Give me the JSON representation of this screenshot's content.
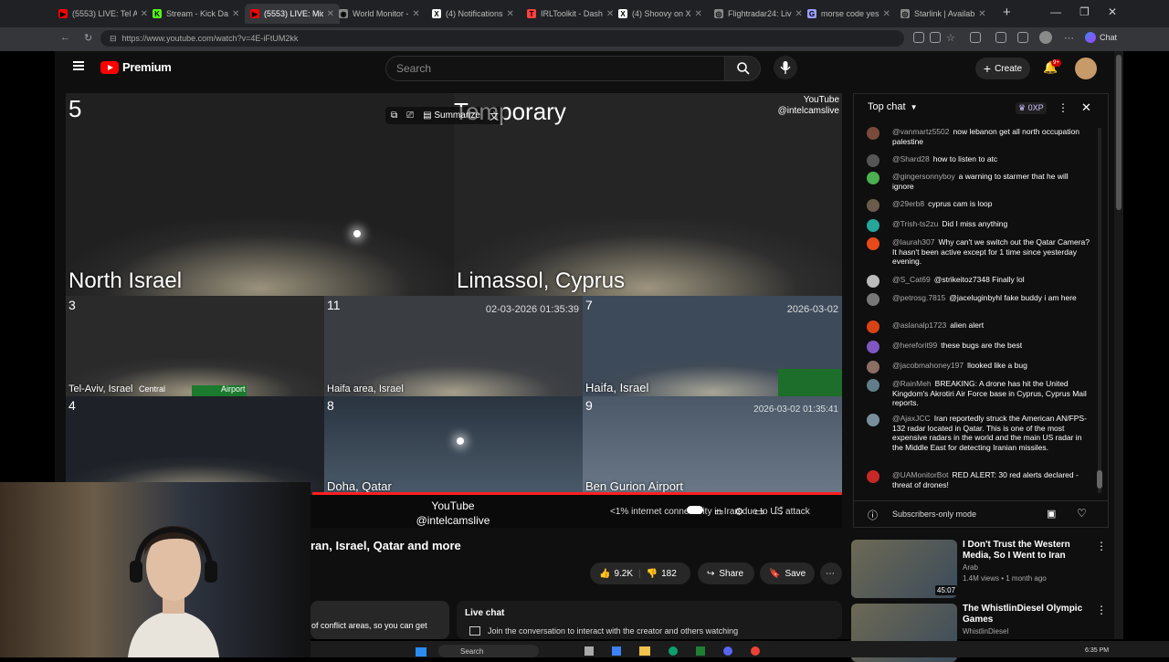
{
  "browser": {
    "tabs": [
      {
        "title": "(5553) LIVE: Tel A",
        "color": "#ff0000",
        "glyph": "▶"
      },
      {
        "title": "Stream - Kick Da",
        "color": "#53fc18",
        "glyph": "K"
      },
      {
        "title": "(5553) LIVE: Mid",
        "color": "#ff0000",
        "glyph": "▶",
        "active": true
      },
      {
        "title": "World Monitor -",
        "color": "#888888",
        "glyph": "◉"
      },
      {
        "title": "(4) Notifications",
        "color": "#ffffff",
        "glyph": "X"
      },
      {
        "title": "IRLToolkit - Dash",
        "color": "#ff4040",
        "glyph": "T"
      },
      {
        "title": "(4) Shoovy on X",
        "color": "#ffffff",
        "glyph": "X"
      },
      {
        "title": "Flightradar24: Liv",
        "color": "#888888",
        "glyph": "◎"
      },
      {
        "title": "morse code yes",
        "color": "#9aa0ff",
        "glyph": "G"
      },
      {
        "title": "Starlink | Availab",
        "color": "#888888",
        "glyph": "◎"
      }
    ],
    "url": "https://www.youtube.com/watch?v=4E-iFtUM2kk",
    "chat_label": "Chat"
  },
  "youtube": {
    "brand": "Premium",
    "search_placeholder": "Search",
    "create_label": "Create",
    "notif_count": "9+",
    "video": {
      "overlay_temporary": "Temporary",
      "summarize_label": "Summarize",
      "channel_watermark": "YouTube\n@intelcamslive",
      "center_watermark_line1": "YouTube",
      "center_watermark_line2": "@intelcamslive",
      "status_text": "<1% internet connectivity in Iran due to US attack",
      "cams": [
        {
          "num": "5",
          "label": "North Israel"
        },
        {
          "num": "",
          "label": "Limassol, Cyprus"
        },
        {
          "num": "3",
          "label": "Tel-Aviv, Israel",
          "extra1": "Central",
          "extra2": "Airport"
        },
        {
          "num": "11",
          "label": "Haifa area, Israel",
          "ts": "02-03-2026 01:35:39"
        },
        {
          "num": "7",
          "label": "Haifa, Israel",
          "ts": "2026-03-02"
        },
        {
          "num": "4",
          "label": ""
        },
        {
          "num": "8",
          "label": "Doha, Qatar"
        },
        {
          "num": "9",
          "label": "Ben Gurion Airport",
          "ts": "2026-03-02 01:35:41"
        }
      ]
    },
    "title": "ran, Israel, Qatar and more",
    "likes": "9.2K",
    "dislikes": "182",
    "share_label": "Share",
    "save_label": "Save",
    "description_snippet": "of conflict areas, so you can get",
    "live_chat_title": "Live chat",
    "live_chat_text": "Join the conversation to interact with the creator and others watching"
  },
  "chat": {
    "header": "Top chat",
    "xp_badge": "0XP",
    "messages": [
      {
        "author": "@vanmartz5502",
        "text": "now lebanon get all north occupation palestine",
        "color": "#7a4b3a"
      },
      {
        "author": "@Shard28",
        "text": "how to listen to atc",
        "color": "#555555"
      },
      {
        "author": "@gingersonnyboy",
        "text": "a warning to starmer that he will ignore",
        "color": "#4caf50"
      },
      {
        "author": "@29erb8",
        "text": "cyprus cam is loop",
        "color": "#6b5b4b"
      },
      {
        "author": "@Trish-ts2zu",
        "text": "Did I miss anything",
        "color": "#26a69a"
      },
      {
        "author": "@laurah307",
        "text": "Why can't we switch out the Qatar Camera? It hasn't been active except for 1 time since yesterday evening.",
        "color": "#e64a19"
      },
      {
        "author": "@S_Cat69",
        "text": "@strikeitoz7348 Finally lol",
        "color": "#bbbbbb"
      },
      {
        "author": "@petrosg.7815",
        "text": "@jaceluginbyhl fake buddy i am here",
        "color": "#777777"
      },
      {
        "author": "@aslanalp1723",
        "text": "alien alert",
        "color": "#d84315"
      },
      {
        "author": "@hereforit99",
        "text": "these bugs are the best",
        "color": "#7e57c2"
      },
      {
        "author": "@jacobmahoney197",
        "text": "llooked like a bug",
        "color": "#8d6e63"
      },
      {
        "author": "@RainMeh",
        "text": "BREAKING: A drone has hit the United Kingdom's Akrotiri Air Force base in Cyprus, Cyprus Mail reports.",
        "color": "#607d8b"
      },
      {
        "author": "@AjaxJCC",
        "text": "Iran reportedly struck the American AN/FPS-132 radar located in Qatar. This is one of the most expensive radars in the world and the main US radar in the Middle East for detecting Iranian missiles.",
        "color": "#78909c"
      },
      {
        "author": "@UAMonitorBot",
        "text": "RED ALERT: 30 red alerts declared - threat of drones!",
        "color": "#c62828"
      }
    ],
    "subscribers_only": "Subscribers-only mode"
  },
  "recommendations": [
    {
      "title": "I Don't Trust the Western Media, So I Went to Iran",
      "channel": "Arab",
      "meta": "1.4M views • 1 month ago",
      "duration": "45:07"
    },
    {
      "title": "The WhistlinDiesel Olympic Games",
      "channel": "WhistlinDiesel",
      "meta": "",
      "duration": ""
    }
  ],
  "taskbar": {
    "search_label": "Search",
    "time": "6:35 PM"
  }
}
